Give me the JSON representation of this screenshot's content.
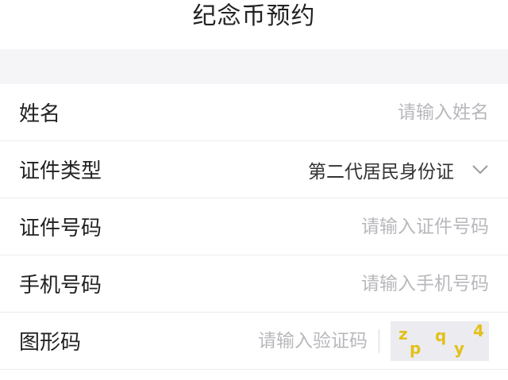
{
  "header": {
    "title": "纪念币预约"
  },
  "form": {
    "name": {
      "label": "姓名",
      "placeholder": "请输入姓名"
    },
    "id_type": {
      "label": "证件类型",
      "value": "第二代居民身份证",
      "icon": "chevron-down-icon"
    },
    "id_number": {
      "label": "证件号码",
      "placeholder": "请输入证件号码"
    },
    "phone": {
      "label": "手机号码",
      "placeholder": "请输入手机号码"
    },
    "captcha": {
      "label": "图形码",
      "placeholder": "请输入验证码",
      "image_chars": [
        "z",
        "p",
        "q",
        "y",
        "4"
      ]
    }
  },
  "colors": {
    "text": "#222222",
    "placeholder": "#b8b8bd",
    "divider": "#ececec",
    "gap_background": "#f5f5f7",
    "captcha_char": "#e2c01a"
  }
}
